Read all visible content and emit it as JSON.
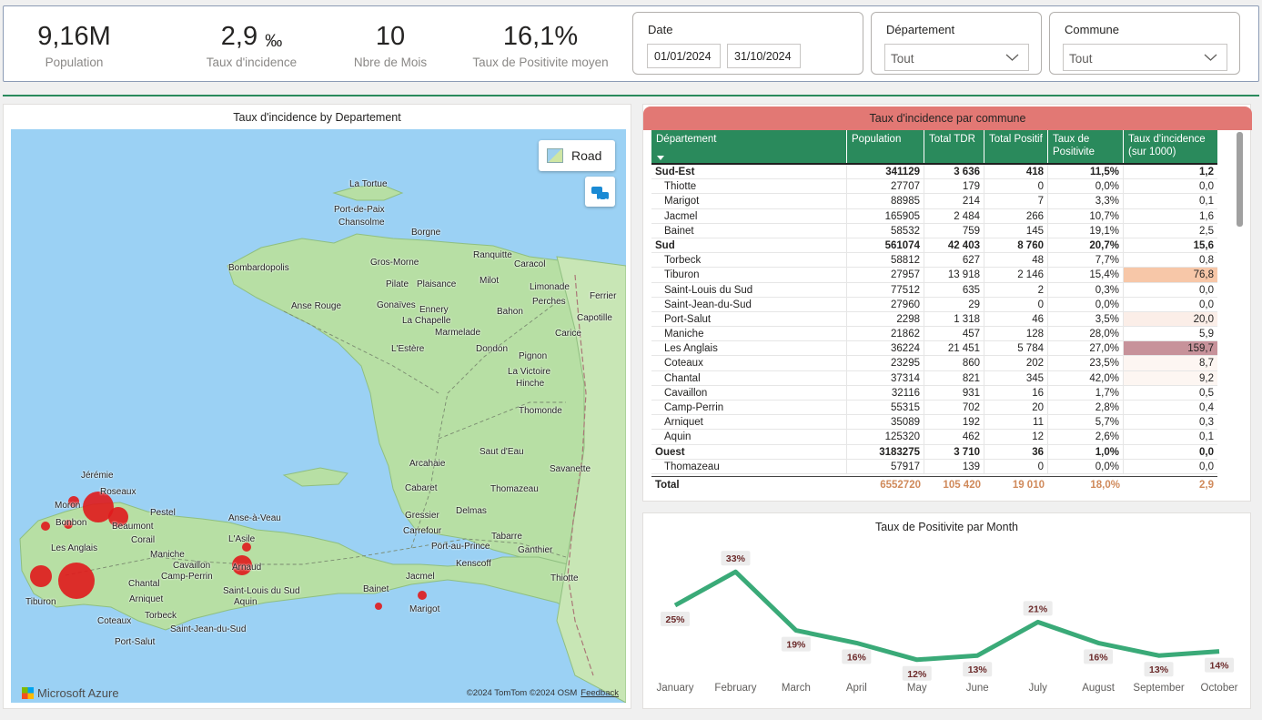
{
  "kpis": [
    {
      "value": "9,16M",
      "unit": "",
      "label": "Population"
    },
    {
      "value": "2,9",
      "unit": "‰",
      "label": "Taux d'incidence"
    },
    {
      "value": "10",
      "unit": "",
      "label": "Nbre de Mois"
    },
    {
      "value": "16,1%",
      "unit": "",
      "label": "Taux de Positivite moyen"
    }
  ],
  "slicers": {
    "date": {
      "title": "Date",
      "start": "01/01/2024",
      "end": "31/10/2024"
    },
    "departement": {
      "title": "Département",
      "value": "Tout"
    },
    "commune": {
      "title": "Commune",
      "value": "Tout"
    }
  },
  "map": {
    "title": "Taux d'incidence by Departement",
    "road_label": "Road",
    "brand": "Microsoft Azure",
    "copyright": "©2024 TomTom  ©2024 OSM",
    "feedback": "Feedback",
    "places": [
      "La Tortue",
      "Port-de-Paix",
      "Chansolme",
      "Borgne",
      "Ranquitte",
      "Caracol",
      "Bombardopolis",
      "Gros-Morne",
      "Milot",
      "Pilate",
      "Plaisance",
      "Limonade",
      "Perches",
      "Ferrier",
      "Anse Rouge",
      "Gonaïves",
      "Ennery",
      "Bahon",
      "Capotille",
      "La Chapelle",
      "Marmelade",
      "Carice",
      "L'Estère",
      "Dondon",
      "Pignon",
      "La Victoire",
      "Hinche",
      "Thomonde",
      "Saut d'Eau",
      "Arcahaie",
      "Savanette",
      "Cabaret",
      "Thomazeau",
      "Jérémie",
      "Roseaux",
      "Moron",
      "Pestel",
      "Bonbon",
      "Beaumont",
      "Corail",
      "Les Anglais",
      "Anse-à-Veau",
      "L'Asile",
      "Gressier",
      "Delmas",
      "Carrefour",
      "Tabarre",
      "Maniche",
      "Cavaillon",
      "Arnaud",
      "Port-au-Prince",
      "Ganthier",
      "Kenscoff",
      "Chantal",
      "Camp-Perrin",
      "Saint-Louis du Sud",
      "Jacmel",
      "Thiotte",
      "Tiburon",
      "Arniquet",
      "Aquin",
      "Bainet",
      "Torbeck",
      "Marigot",
      "Coteaux",
      "Saint-Jean-du-Sud",
      "Port-Salut"
    ],
    "markers": [
      "Jérémie",
      "Moron",
      "Roseaux",
      "Bonbon",
      "Beaumont",
      "Les Anglais",
      "Tiburon",
      "Arnaud",
      "L'Asile",
      "Marigot",
      "Bainet"
    ]
  },
  "table": {
    "title": "Taux d'incidence par commune",
    "headers": [
      "Département",
      "Population",
      "Total TDR",
      "Total Positif",
      "Taux de Positivite",
      "Taux d'incidence (sur 1000)"
    ],
    "rows": [
      {
        "name": "Sud-Est",
        "group": true,
        "pop": "341129",
        "tdr": "3 636",
        "pos": "418",
        "taux": "11,5%",
        "inc": "1,2",
        "heat": 0
      },
      {
        "name": "Thiotte",
        "pop": "27707",
        "tdr": "179",
        "pos": "0",
        "taux": "0,0%",
        "inc": "0,0",
        "heat": 0
      },
      {
        "name": "Marigot",
        "pop": "88985",
        "tdr": "214",
        "pos": "7",
        "taux": "3,3%",
        "inc": "0,1",
        "heat": 0
      },
      {
        "name": "Jacmel",
        "pop": "165905",
        "tdr": "2 484",
        "pos": "266",
        "taux": "10,7%",
        "inc": "1,6",
        "heat": 0
      },
      {
        "name": "Bainet",
        "pop": "58532",
        "tdr": "759",
        "pos": "145",
        "taux": "19,1%",
        "inc": "2,5",
        "heat": 0
      },
      {
        "name": "Sud",
        "group": true,
        "pop": "561074",
        "tdr": "42 403",
        "pos": "8 760",
        "taux": "20,7%",
        "inc": "15,6",
        "heat": 0
      },
      {
        "name": "Torbeck",
        "pop": "58812",
        "tdr": "627",
        "pos": "48",
        "taux": "7,7%",
        "inc": "0,8",
        "heat": 0
      },
      {
        "name": "Tiburon",
        "pop": "27957",
        "tdr": "13 918",
        "pos": "2 146",
        "taux": "15,4%",
        "inc": "76,8",
        "heat": 2
      },
      {
        "name": "Saint-Louis du Sud",
        "pop": "77512",
        "tdr": "635",
        "pos": "2",
        "taux": "0,3%",
        "inc": "0,0",
        "heat": 0
      },
      {
        "name": "Saint-Jean-du-Sud",
        "pop": "27960",
        "tdr": "29",
        "pos": "0",
        "taux": "0,0%",
        "inc": "0,0",
        "heat": 0
      },
      {
        "name": "Port-Salut",
        "pop": "2298",
        "tdr": "1 318",
        "pos": "46",
        "taux": "3,5%",
        "inc": "20,0",
        "heat": 1
      },
      {
        "name": "Maniche",
        "pop": "21862",
        "tdr": "457",
        "pos": "128",
        "taux": "28,0%",
        "inc": "5,9",
        "heat": 0
      },
      {
        "name": "Les Anglais",
        "pop": "36224",
        "tdr": "21 451",
        "pos": "5 784",
        "taux": "27,0%",
        "inc": "159,7",
        "heat": 3
      },
      {
        "name": "Coteaux",
        "pop": "23295",
        "tdr": "860",
        "pos": "202",
        "taux": "23,5%",
        "inc": "8,7",
        "heat": 0.5
      },
      {
        "name": "Chantal",
        "pop": "37314",
        "tdr": "821",
        "pos": "345",
        "taux": "42,0%",
        "inc": "9,2",
        "heat": 0.5
      },
      {
        "name": "Cavaillon",
        "pop": "32116",
        "tdr": "931",
        "pos": "16",
        "taux": "1,7%",
        "inc": "0,5",
        "heat": 0
      },
      {
        "name": "Camp-Perrin",
        "pop": "55315",
        "tdr": "702",
        "pos": "20",
        "taux": "2,8%",
        "inc": "0,4",
        "heat": 0
      },
      {
        "name": "Arniquet",
        "pop": "35089",
        "tdr": "192",
        "pos": "11",
        "taux": "5,7%",
        "inc": "0,3",
        "heat": 0
      },
      {
        "name": "Aquin",
        "pop": "125320",
        "tdr": "462",
        "pos": "12",
        "taux": "2,6%",
        "inc": "0,1",
        "heat": 0
      },
      {
        "name": "Ouest",
        "group": true,
        "pop": "3183275",
        "tdr": "3 710",
        "pos": "36",
        "taux": "1,0%",
        "inc": "0,0",
        "heat": 0
      },
      {
        "name": "Thomazeau",
        "pop": "57917",
        "tdr": "139",
        "pos": "0",
        "taux": "0,0%",
        "inc": "0,0",
        "heat": 0
      }
    ],
    "total": {
      "label": "Total",
      "pop": "6552720",
      "tdr": "105 420",
      "pos": "19 010",
      "taux": "18,0%",
      "inc": "2,9"
    }
  },
  "colors": {
    "accent": "#2a8a5c",
    "title_bar": "#e27874",
    "line": "#3aaa78",
    "heat_low": "#fbeee8",
    "heat_mid": "#f7c7a8",
    "heat_high": "#c7929a"
  },
  "chart_data": {
    "type": "line",
    "title": "Taux de Positivite par Month",
    "categories": [
      "January",
      "February",
      "March",
      "April",
      "May",
      "June",
      "July",
      "August",
      "September",
      "October"
    ],
    "values": [
      25,
      33,
      19,
      16,
      12,
      13,
      21,
      16,
      13,
      14
    ],
    "labels": [
      "25%",
      "33%",
      "19%",
      "16%",
      "12%",
      "13%",
      "21%",
      "16%",
      "13%",
      "14%"
    ],
    "xlabel": "",
    "ylabel": "",
    "ylim": [
      10,
      35
    ],
    "grid": false,
    "legend": "none"
  }
}
